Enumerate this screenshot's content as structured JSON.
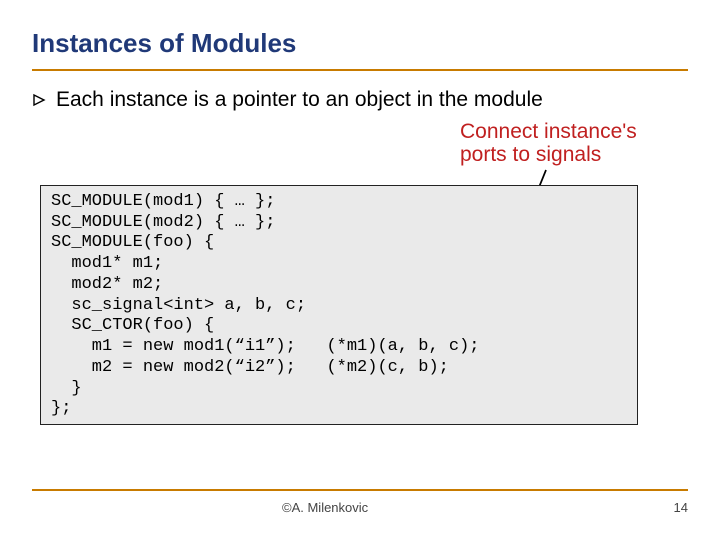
{
  "title": "Instances of Modules",
  "bullet": {
    "text": "Each instance is a pointer to an object in the module"
  },
  "annotation": {
    "line1": "Connect instance's",
    "line2": "ports to signals"
  },
  "code": {
    "l1": "SC_MODULE(mod1) { … };",
    "l2": "SC_MODULE(mod2) { … };",
    "l3": "SC_MODULE(foo) {",
    "l4": "  mod1* m1;",
    "l5": "  mod2* m2;",
    "l6": "  sc_signal<int> a, b, c;",
    "l7": "  SC_CTOR(foo) {",
    "l8": "    m1 = new mod1(“i1”);   (*m1)(a, b, c);",
    "l9": "    m2 = new mod2(“i2”);   (*m2)(c, b);",
    "l10": "  }",
    "l11": "};"
  },
  "footer": {
    "author": "©A. Milenkovic",
    "page": "14"
  }
}
